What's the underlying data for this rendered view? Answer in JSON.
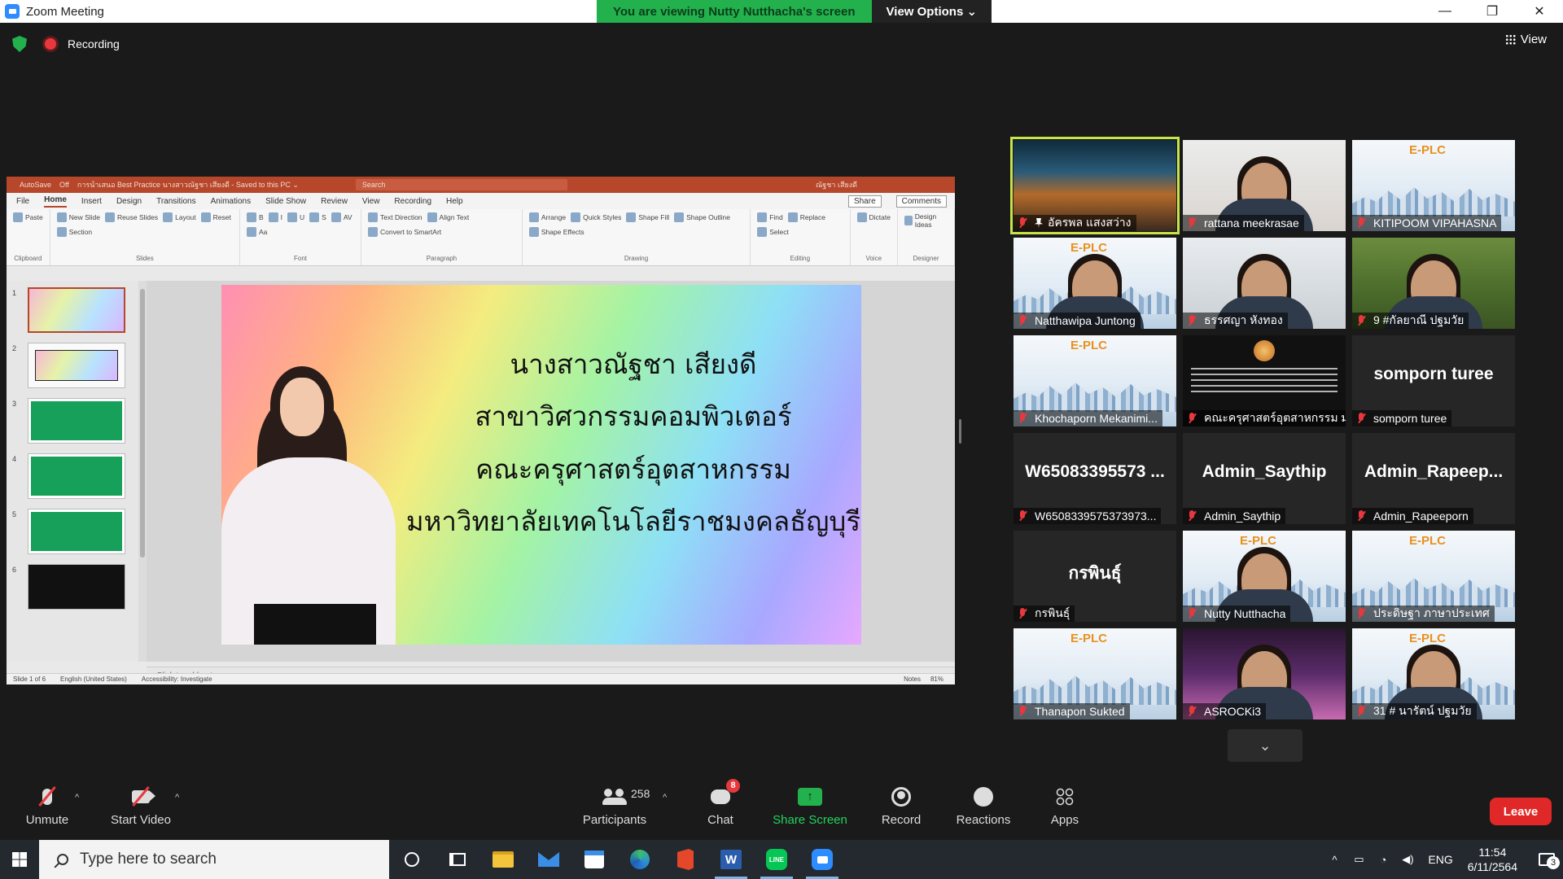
{
  "window": {
    "title": "Zoom Meeting",
    "banner_message": "You are viewing Nutty Nutthacha's screen",
    "view_options": "View Options ⌄",
    "minimize": "—",
    "restore": "❐",
    "close": "✕"
  },
  "meeting": {
    "recording_label": "Recording",
    "view_label": "View"
  },
  "shared_screen": {
    "title_bar": {
      "autosave": "AutoSave",
      "autosave_state": "Off",
      "doc_title": "การนำเสนอ Best Practice นางสาวณัฐชา เสียงดี - Saved to this PC ⌄",
      "search": "Search",
      "user": "ณัฐชา เสียงดี"
    },
    "tabs": [
      "File",
      "Home",
      "Insert",
      "Design",
      "Transitions",
      "Animations",
      "Slide Show",
      "Review",
      "View",
      "Recording",
      "Help"
    ],
    "active_tab": "Home",
    "share_btn": "Share",
    "comments_btn": "Comments",
    "ribbon_groups": [
      {
        "name": "Clipboard",
        "items": [
          "Paste"
        ]
      },
      {
        "name": "Slides",
        "items": [
          "New Slide",
          "Reuse Slides",
          "Layout",
          "Reset",
          "Section"
        ]
      },
      {
        "name": "Font",
        "items": [
          "B",
          "I",
          "U",
          "S",
          "AV",
          "Aa"
        ]
      },
      {
        "name": "Paragraph",
        "items": [
          "Text Direction",
          "Align Text",
          "Convert to SmartArt"
        ]
      },
      {
        "name": "Drawing",
        "items": [
          "Arrange",
          "Quick Styles",
          "Shape Fill",
          "Shape Outline",
          "Shape Effects"
        ]
      },
      {
        "name": "Editing",
        "items": [
          "Find",
          "Replace",
          "Select"
        ]
      },
      {
        "name": "Voice",
        "items": [
          "Dictate"
        ]
      },
      {
        "name": "Designer",
        "items": [
          "Design Ideas"
        ]
      }
    ],
    "thumbnails": [
      "1",
      "2",
      "3",
      "4",
      "5",
      "6"
    ],
    "slide_lines": [
      "นางสาวณัฐชา   เสียงดี",
      "สาขาวิศวกรรมคอมพิวเตอร์",
      "คณะครุศาสตร์อุตสาหกรรม",
      "มหาวิทยาลัยเทคโนโลยีราชมงคลธัญบุรี"
    ],
    "notes_placeholder": "Click to add notes",
    "status": {
      "slide": "Slide 1 of 6",
      "language": "English (United States)",
      "accessibility": "Accessibility: Investigate",
      "notes": "Notes",
      "zoom": "81%"
    }
  },
  "participants": [
    {
      "name": "อัครพล แสงสว่าง",
      "bg": "cafe",
      "speaking": true,
      "pinned": true
    },
    {
      "name": "rattana meekrasae",
      "bg": "woman"
    },
    {
      "name": "KITIPOOM VIPAHASNA",
      "bg": "plc"
    },
    {
      "name": "Natthawipa Juntong",
      "bg": "plc",
      "face": true
    },
    {
      "name": "ธรรศญา หังทอง",
      "bg": "room"
    },
    {
      "name": "9 #กัลยาณี ปฐมวัย",
      "bg": "garden"
    },
    {
      "name": "Khochaporn Mekanimi...",
      "bg": "plc"
    },
    {
      "name": "คณะครุศาสตร์อุตสาหกรรม มห...",
      "bg": "poster"
    },
    {
      "name": "somporn turee",
      "big": "somporn turee"
    },
    {
      "name": "W6508339575373973...",
      "big": "W65083395573 ..."
    },
    {
      "name": "Admin_Saythip",
      "big": "Admin_Saythip"
    },
    {
      "name": "Admin_Rapeeporn",
      "big": "Admin_Rapeep..."
    },
    {
      "name": "กรพินธุ์",
      "big": "กรพินธุ์"
    },
    {
      "name": "Nutty Nutthacha",
      "bg": "plc",
      "face": true
    },
    {
      "name": "ประดิษฐา ภาษาประเทศ",
      "bg": "plc"
    },
    {
      "name": "Thanapon Sukted",
      "bg": "plc"
    },
    {
      "name": "ASROCKi3",
      "bg": "purple"
    },
    {
      "name": "31 # นารัตน์ ปฐมวัย",
      "bg": "plc",
      "face": true
    }
  ],
  "toolbar": {
    "unmute": "Unmute",
    "start_video": "Start Video",
    "participants": "Participants",
    "participants_count": "258",
    "chat": "Chat",
    "chat_badge": "8",
    "share_screen": "Share Screen",
    "record": "Record",
    "reactions": "Reactions",
    "apps": "Apps",
    "leave": "Leave"
  },
  "taskbar": {
    "search_placeholder": "Type here to search",
    "word_letter": "W",
    "line_label": "LINE",
    "language": "ENG",
    "time": "11:54",
    "date": "6/11/2564",
    "notification_count": "3"
  },
  "colors": {
    "zoom_green": "#23b14d",
    "leave_red": "#e02828",
    "speaker_highlight": "#c8e34a",
    "powerpoint_accent": "#b7472a"
  }
}
